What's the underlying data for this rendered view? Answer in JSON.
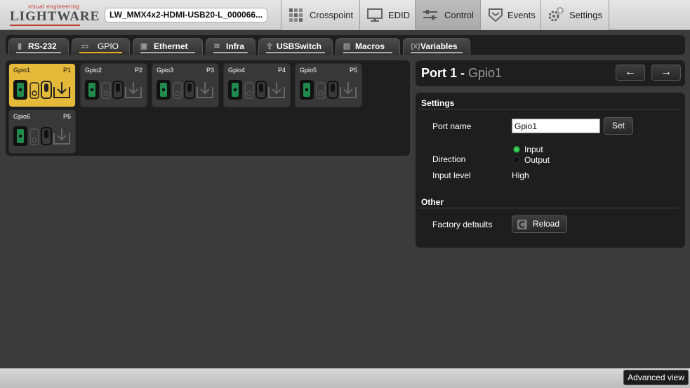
{
  "app": {
    "logo_tagline": "visual engineering",
    "logo_name": "LIGHTWARE",
    "device_name": "LW_MMX4x2-HDMI-USB20-L_000066..."
  },
  "nav": {
    "tabs": [
      {
        "label": "Crosspoint",
        "icon": "crosspoint-icon",
        "active": false
      },
      {
        "label": "EDID",
        "icon": "monitor-icon",
        "active": false
      },
      {
        "label": "Control",
        "icon": "sliders-icon",
        "active": true
      },
      {
        "label": "Events",
        "icon": "events-icon",
        "active": false
      },
      {
        "label": "Settings",
        "icon": "gears-icon",
        "active": false
      }
    ]
  },
  "subtabs": {
    "items": [
      {
        "label": "RS-232",
        "icon": "serial-icon",
        "active": false
      },
      {
        "label": "GPIO",
        "icon": "gpio-icon",
        "active": true
      },
      {
        "label": "Ethernet",
        "icon": "ethernet-icon",
        "active": false
      },
      {
        "label": "Infra",
        "icon": "infrared-icon",
        "active": false
      },
      {
        "label": "USBSwitch",
        "icon": "usb-icon",
        "active": false
      },
      {
        "label": "Macros",
        "icon": "document-icon",
        "active": false
      },
      {
        "label": "Variables",
        "icon": "variable-icon",
        "active": false
      }
    ]
  },
  "gpio": {
    "ports": [
      {
        "name": "Gpio1",
        "port": "P1",
        "active": true
      },
      {
        "name": "Gpio2",
        "port": "P2",
        "active": false
      },
      {
        "name": "Gpio3",
        "port": "P3",
        "active": false
      },
      {
        "name": "Gpio4",
        "port": "P4",
        "active": false
      },
      {
        "name": "Gpio5",
        "port": "P5",
        "active": false
      },
      {
        "name": "Gpio6",
        "port": "P6",
        "active": false
      }
    ]
  },
  "port_detail": {
    "title": "Port 1",
    "separator": " - ",
    "subtitle": "Gpio1",
    "prev_label": "←",
    "next_label": "→"
  },
  "settings": {
    "section_title": "Settings",
    "port_name_label": "Port name",
    "port_name_value": "Gpio1",
    "set_label": "Set",
    "direction_label": "Direction",
    "direction_options": [
      "Input",
      "Output"
    ],
    "direction_selected": "Input",
    "input_level_label": "Input level",
    "input_level_value": "High"
  },
  "other": {
    "section_title": "Other",
    "factory_defaults_label": "Factory defaults",
    "reload_label": "Reload"
  },
  "footer": {
    "advanced_view_label": "Advanced view"
  },
  "colors": {
    "accent": "#e8a91c",
    "active_card": "#e5ba3a",
    "gpio_green": "#1f8a4c",
    "radio_green": "#3fd15a"
  }
}
